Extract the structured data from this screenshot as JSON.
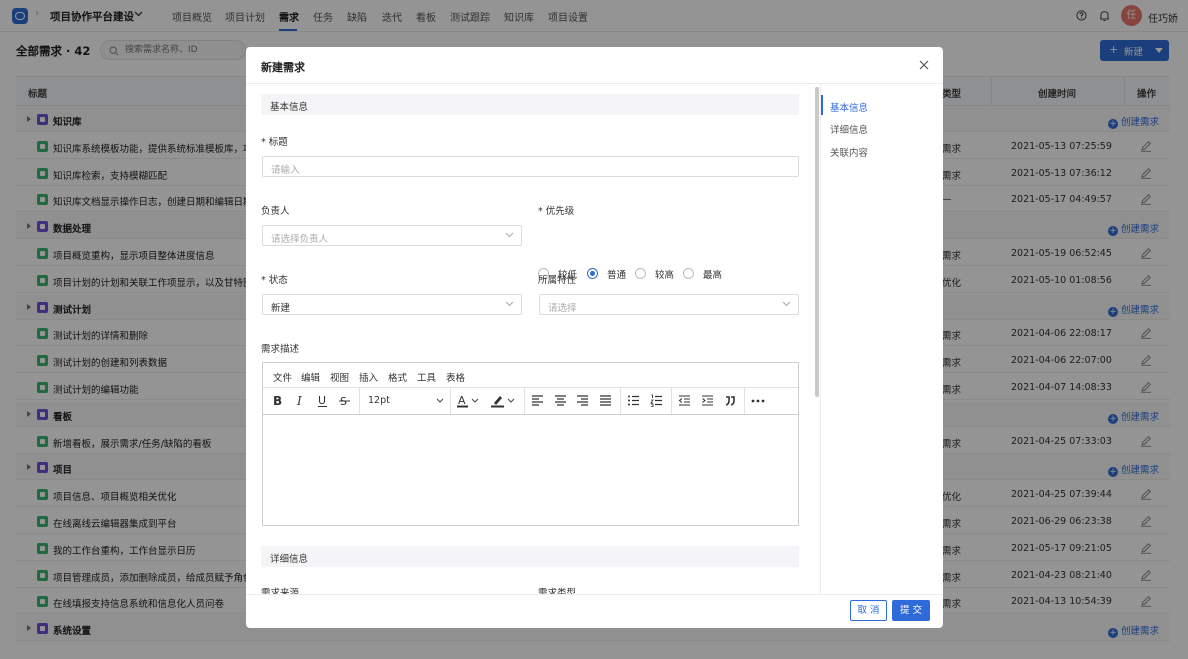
{
  "app": {
    "project_name": "项目协作平台建设",
    "user_name": "任巧娇",
    "avatar_text": "任",
    "accent": "#2f6bd8"
  },
  "nav": {
    "items": [
      "项目概览",
      "项目计划",
      "需求",
      "任务",
      "缺陷",
      "迭代",
      "看板",
      "测试跟踪",
      "知识库",
      "项目设置"
    ],
    "active": "需求"
  },
  "page": {
    "title": "全部需求 · 42",
    "search_placeholder": "搜索需求名称、ID",
    "new_button": "新建"
  },
  "table": {
    "headers": {
      "title": "标题",
      "type": "类型",
      "created": "创建时间",
      "action": "操作"
    },
    "create_link": "创建需求",
    "rows": [
      {
        "kind": "group",
        "name": "知识库"
      },
      {
        "kind": "item",
        "title": "知识库系统模板功能，提供系统标准模板库，项",
        "type": "需求",
        "created": "2021-05-13 07:25:59"
      },
      {
        "kind": "item",
        "title": "知识库检索，支持模糊匹配",
        "type": "需求",
        "created": "2021-05-13 07:36:12"
      },
      {
        "kind": "item",
        "title": "知识库文档显示操作日志，创建日期和编辑日期",
        "type": "—",
        "created": "2021-05-17 04:49:57"
      },
      {
        "kind": "group",
        "name": "数据处理"
      },
      {
        "kind": "item",
        "title": "项目概览重构，显示项目整体进度信息",
        "type": "需求",
        "created": "2021-05-19 06:52:45"
      },
      {
        "kind": "item",
        "title": "项目计划的计划和关联工作项显示，以及甘特图",
        "type": "优化",
        "created": "2021-05-10 01:08:56"
      },
      {
        "kind": "group",
        "name": "测试计划"
      },
      {
        "kind": "item",
        "title": "测试计划的详情和删除",
        "type": "需求",
        "created": "2021-04-06 22:08:17"
      },
      {
        "kind": "item",
        "title": "测试计划的创建和列表数据",
        "type": "需求",
        "created": "2021-04-06 22:07:00"
      },
      {
        "kind": "item",
        "title": "测试计划的编辑功能",
        "type": "需求",
        "created": "2021-04-07 14:08:33"
      },
      {
        "kind": "group",
        "name": "看板"
      },
      {
        "kind": "item",
        "title": "新增看板，展示需求/任务/缺陷的看板",
        "type": "需求",
        "created": "2021-04-25 07:33:03"
      },
      {
        "kind": "group",
        "name": "项目"
      },
      {
        "kind": "item",
        "title": "项目信息、项目概览相关优化",
        "type": "优化",
        "created": "2021-04-25 07:39:44"
      },
      {
        "kind": "item",
        "title": "在线离线云编辑器集成到平台",
        "type": "需求",
        "created": "2021-06-29 06:23:38"
      },
      {
        "kind": "item",
        "title": "我的工作台重构，工作台显示日历",
        "type": "需求",
        "created": "2021-05-17 09:21:05"
      },
      {
        "kind": "item",
        "title": "项目管理成员，添加删除成员，给成员赋予角色",
        "type": "需求",
        "created": "2021-04-23 08:21:40"
      },
      {
        "kind": "item",
        "title": "在线填报支持信息系统和信息化人员问卷",
        "type": "需求",
        "created": "2021-04-13 10:54:39"
      },
      {
        "kind": "group",
        "name": "系统设置"
      }
    ]
  },
  "modal": {
    "title": "新建需求",
    "section_basic": "基本信息",
    "section_detail": "详细信息",
    "anchors": [
      "基本信息",
      "详细信息",
      "关联内容"
    ],
    "fields": {
      "title_label": "标题",
      "title_placeholder": "请输入",
      "owner_label": "负责人",
      "owner_placeholder": "请选择负责人",
      "priority_label": "优先级",
      "priority_options": [
        "较低",
        "普通",
        "较高",
        "最高"
      ],
      "priority_selected": "普通",
      "status_label": "状态",
      "status_value": "新建",
      "feature_label": "所属特性",
      "feature_placeholder": "请选择",
      "desc_label": "需求描述",
      "source_label": "需求来源",
      "type_label": "需求类型"
    },
    "editor": {
      "menus": [
        "文件",
        "编辑",
        "视图",
        "插入",
        "格式",
        "工具",
        "表格"
      ],
      "font_size": "12pt"
    },
    "cancel": "取 消",
    "submit": "提 交"
  }
}
